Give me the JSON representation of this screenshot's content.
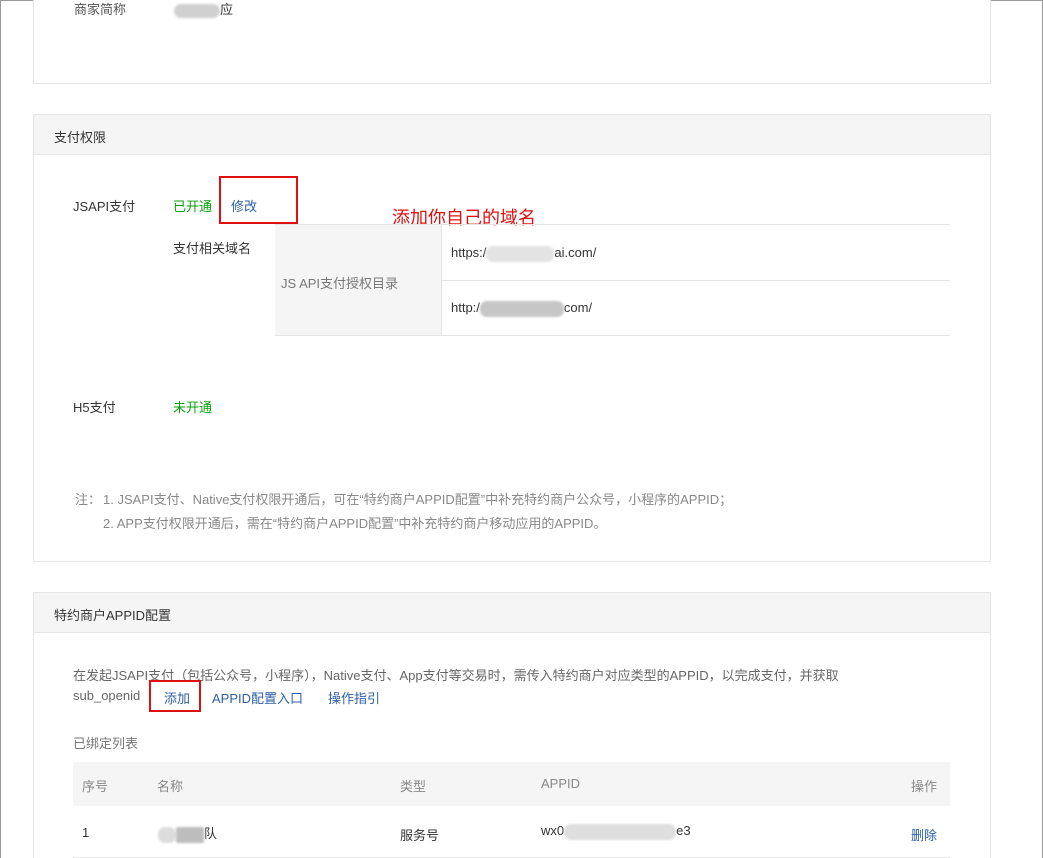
{
  "merchant": {
    "short_name_label": "商家简称",
    "short_name_suffix": "应"
  },
  "payment_permissions": {
    "title": "支付权限",
    "jsapi": {
      "label": "JSAPI支付",
      "status": "已开通",
      "edit_link": "修改",
      "domain_label": "支付相关域名",
      "table_header": "JS API支付授权目录",
      "domains": [
        {
          "prefix": "https:/",
          "suffix": "ai.com/"
        },
        {
          "prefix": "http:/",
          "suffix": "com/"
        }
      ]
    },
    "annotation": "添加你自己的域名",
    "h5": {
      "label": "H5支付",
      "status": "未开通"
    },
    "notes": {
      "prefix": "注：",
      "line1": "1. JSAPI支付、Native支付权限开通后，可在“特约商户APPID配置”中补充特约商户公众号，小程序的APPID；",
      "line2": "2. APP支付权限开通后，需在“特约商户APPID配置”中补充特约商户移动应用的APPID。"
    }
  },
  "appid_config": {
    "title": "特约商户APPID配置",
    "description_line1": "在发起JSAPI支付（包括公众号，小程序），Native支付、App支付等交易时，需传入特约商户对应类型的APPID，以完成支付，并获取",
    "description_line2": "sub_openid",
    "add_link": "添加",
    "entry_link": "APPID配置入口",
    "guide_link": "操作指引",
    "bound_list_title": "已绑定列表",
    "table": {
      "headers": [
        "序号",
        "名称",
        "类型",
        "APPID",
        "操作"
      ],
      "rows": [
        {
          "index": "1",
          "name_suffix": "队",
          "type": "服务号",
          "appid_prefix": "wx0",
          "appid_suffix": "e3",
          "action": "删除"
        }
      ]
    }
  },
  "colors": {
    "enabled": "#07a10a",
    "link": "#2d5fa6",
    "annotation": "#e01010"
  }
}
